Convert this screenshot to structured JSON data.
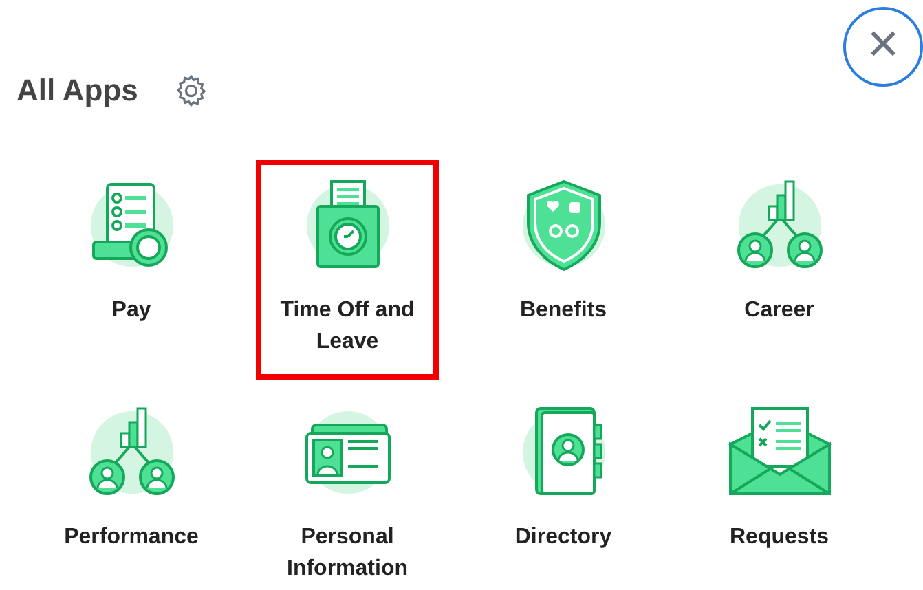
{
  "header": {
    "title": "All Apps",
    "close_label": "×"
  },
  "apps": [
    {
      "label": "Pay",
      "kind": "pay",
      "highlighted": false
    },
    {
      "label": "Time Off and Leave",
      "kind": "timeoff",
      "highlighted": true
    },
    {
      "label": "Benefits",
      "kind": "benefits",
      "highlighted": false
    },
    {
      "label": "Career",
      "kind": "career",
      "highlighted": false
    },
    {
      "label": "Performance",
      "kind": "career",
      "highlighted": false
    },
    {
      "label": "Personal Information",
      "kind": "card",
      "highlighted": false
    },
    {
      "label": "Directory",
      "kind": "directory",
      "highlighted": false
    },
    {
      "label": "Requests",
      "kind": "requests",
      "highlighted": false
    }
  ]
}
